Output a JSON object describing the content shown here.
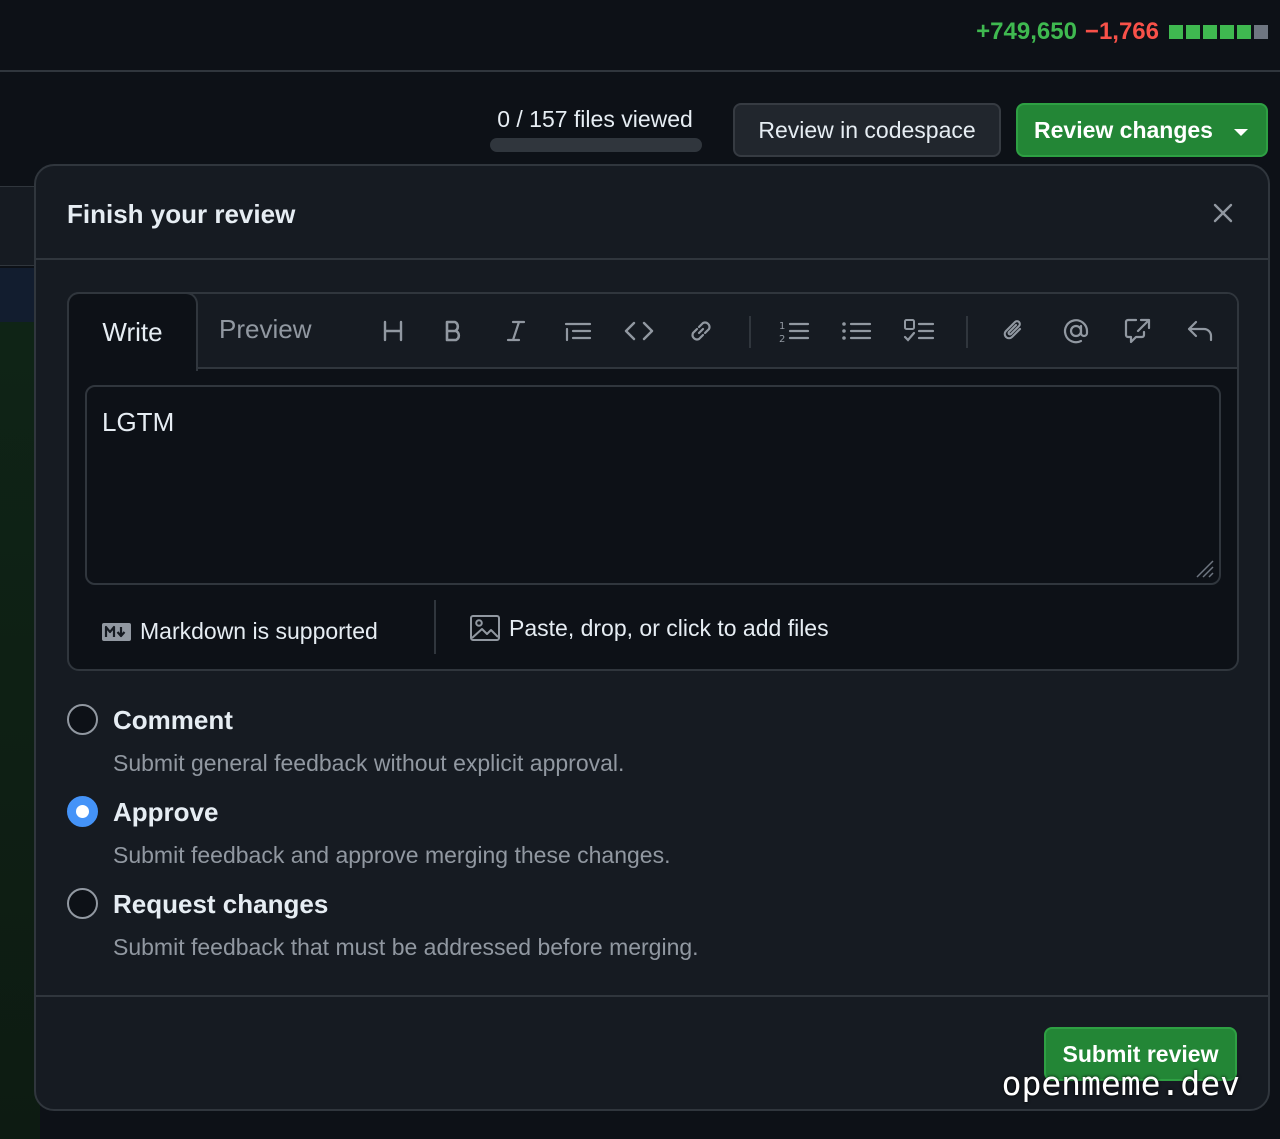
{
  "diffstat": {
    "additions": "+749,650",
    "deletions": "−1,766",
    "blocks": [
      "add",
      "add",
      "add",
      "add",
      "add",
      "neutral"
    ],
    "add_color": "#3fb950",
    "del_color": "#f85149"
  },
  "files_viewed": {
    "label": "0 / 157 files viewed",
    "progress_fraction": 0
  },
  "toolbar": {
    "codespace_label": "Review in codespace",
    "review_changes_label": "Review changes"
  },
  "review_dialog": {
    "title": "Finish your review",
    "close_icon": "close-icon",
    "tabs": {
      "write": "Write",
      "preview": "Preview"
    },
    "format_icons": [
      "heading-icon",
      "bold-icon",
      "italic-icon",
      "quote-icon",
      "code-icon",
      "link-icon",
      "ordered-list-icon",
      "unordered-list-icon",
      "task-list-icon",
      "attach-icon",
      "mention-icon",
      "cross-reference-icon",
      "reply-icon"
    ],
    "comment_text": "LGTM",
    "markdown_note": "Markdown is supported",
    "attach_note": "Paste, drop, or click to add files",
    "options": [
      {
        "title": "Comment",
        "description": "Submit general feedback without explicit approval.",
        "checked": false
      },
      {
        "title": "Approve",
        "description": "Submit feedback and approve merging these changes.",
        "checked": true
      },
      {
        "title": "Request changes",
        "description": "Submit feedback that must be addressed before merging.",
        "checked": false
      }
    ],
    "submit_label": "Submit review",
    "accent_color": "#238636",
    "radio_color": "#4493f8"
  },
  "watermark": "openmeme.dev"
}
